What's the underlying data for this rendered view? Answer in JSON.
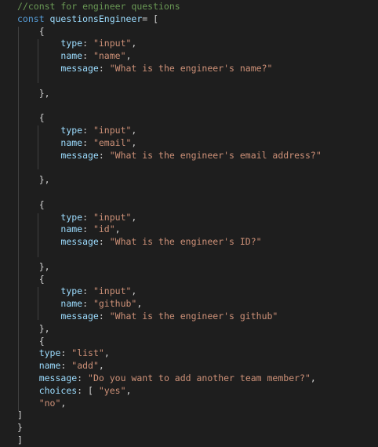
{
  "editor": {
    "theme_colors": {
      "background": "#1e1e1e",
      "comment": "#6a9955",
      "keyword": "#569cd6",
      "property": "#9cdcfe",
      "string": "#ce9178",
      "text": "#d4d4d4"
    },
    "lines": [
      {
        "indent": 0,
        "tokens": [
          {
            "t": "c",
            "v": "//const for engineer questions"
          }
        ]
      },
      {
        "indent": 0,
        "tokens": [
          {
            "t": "k",
            "v": "const "
          },
          {
            "t": "v",
            "v": "questionsEngineer"
          },
          {
            "t": "p",
            "v": "= ["
          }
        ]
      },
      {
        "indent": 1,
        "tokens": [
          {
            "t": "p",
            "v": "{"
          }
        ]
      },
      {
        "indent": 2,
        "tokens": [
          {
            "t": "v",
            "v": "type"
          },
          {
            "t": "p",
            "v": ": "
          },
          {
            "t": "s",
            "v": "\"input\""
          },
          {
            "t": "p",
            "v": ","
          }
        ]
      },
      {
        "indent": 2,
        "tokens": [
          {
            "t": "v",
            "v": "name"
          },
          {
            "t": "p",
            "v": ": "
          },
          {
            "t": "s",
            "v": "\"name\""
          },
          {
            "t": "p",
            "v": ","
          }
        ]
      },
      {
        "indent": 2,
        "tokens": [
          {
            "t": "v",
            "v": "message"
          },
          {
            "t": "p",
            "v": ": "
          },
          {
            "t": "s",
            "v": "\"What is the engineer's name?\""
          }
        ]
      },
      {
        "indent": 0,
        "tokens": []
      },
      {
        "indent": 1,
        "tokens": [
          {
            "t": "p",
            "v": "},"
          }
        ]
      },
      {
        "indent": 0,
        "tokens": []
      },
      {
        "indent": 1,
        "tokens": [
          {
            "t": "p",
            "v": "{"
          }
        ]
      },
      {
        "indent": 2,
        "tokens": [
          {
            "t": "v",
            "v": "type"
          },
          {
            "t": "p",
            "v": ": "
          },
          {
            "t": "s",
            "v": "\"input\""
          },
          {
            "t": "p",
            "v": ","
          }
        ]
      },
      {
        "indent": 2,
        "tokens": [
          {
            "t": "v",
            "v": "name"
          },
          {
            "t": "p",
            "v": ": "
          },
          {
            "t": "s",
            "v": "\"email\""
          },
          {
            "t": "p",
            "v": ","
          }
        ]
      },
      {
        "indent": 2,
        "tokens": [
          {
            "t": "v",
            "v": "message"
          },
          {
            "t": "p",
            "v": ": "
          },
          {
            "t": "s",
            "v": "\"What is the engineer's email address?\""
          }
        ]
      },
      {
        "indent": 0,
        "tokens": []
      },
      {
        "indent": 1,
        "tokens": [
          {
            "t": "p",
            "v": "},"
          }
        ]
      },
      {
        "indent": 0,
        "tokens": []
      },
      {
        "indent": 1,
        "tokens": [
          {
            "t": "p",
            "v": "{"
          }
        ]
      },
      {
        "indent": 2,
        "tokens": [
          {
            "t": "v",
            "v": "type"
          },
          {
            "t": "p",
            "v": ": "
          },
          {
            "t": "s",
            "v": "\"input\""
          },
          {
            "t": "p",
            "v": ","
          }
        ]
      },
      {
        "indent": 2,
        "tokens": [
          {
            "t": "v",
            "v": "name"
          },
          {
            "t": "p",
            "v": ": "
          },
          {
            "t": "s",
            "v": "\"id\""
          },
          {
            "t": "p",
            "v": ","
          }
        ]
      },
      {
        "indent": 2,
        "tokens": [
          {
            "t": "v",
            "v": "message"
          },
          {
            "t": "p",
            "v": ": "
          },
          {
            "t": "s",
            "v": "\"What is the engineer's ID?\""
          }
        ]
      },
      {
        "indent": 0,
        "tokens": []
      },
      {
        "indent": 1,
        "tokens": [
          {
            "t": "p",
            "v": "},"
          }
        ]
      },
      {
        "indent": 1,
        "tokens": [
          {
            "t": "p",
            "v": "{"
          }
        ]
      },
      {
        "indent": 2,
        "tokens": [
          {
            "t": "v",
            "v": "type"
          },
          {
            "t": "p",
            "v": ": "
          },
          {
            "t": "s",
            "v": "\"input\""
          },
          {
            "t": "p",
            "v": ","
          }
        ]
      },
      {
        "indent": 2,
        "tokens": [
          {
            "t": "v",
            "v": "name"
          },
          {
            "t": "p",
            "v": ": "
          },
          {
            "t": "s",
            "v": "\"github\""
          },
          {
            "t": "p",
            "v": ","
          }
        ]
      },
      {
        "indent": 2,
        "tokens": [
          {
            "t": "v",
            "v": "message"
          },
          {
            "t": "p",
            "v": ": "
          },
          {
            "t": "s",
            "v": "\"What is the engineer's github\""
          }
        ]
      },
      {
        "indent": 1,
        "tokens": [
          {
            "t": "p",
            "v": "},"
          }
        ]
      },
      {
        "indent": 1,
        "tokens": [
          {
            "t": "p",
            "v": "{"
          }
        ]
      },
      {
        "indent": 1,
        "tokens": [
          {
            "t": "v",
            "v": "type"
          },
          {
            "t": "p",
            "v": ": "
          },
          {
            "t": "s",
            "v": "\"list\""
          },
          {
            "t": "p",
            "v": ","
          }
        ]
      },
      {
        "indent": 1,
        "tokens": [
          {
            "t": "v",
            "v": "name"
          },
          {
            "t": "p",
            "v": ": "
          },
          {
            "t": "s",
            "v": "\"add\""
          },
          {
            "t": "p",
            "v": ","
          }
        ]
      },
      {
        "indent": 1,
        "tokens": [
          {
            "t": "v",
            "v": "message"
          },
          {
            "t": "p",
            "v": ": "
          },
          {
            "t": "s",
            "v": "\"Do you want to add another team member?\""
          },
          {
            "t": "p",
            "v": ","
          }
        ]
      },
      {
        "indent": 1,
        "tokens": [
          {
            "t": "v",
            "v": "choices"
          },
          {
            "t": "p",
            "v": ": [ "
          },
          {
            "t": "s",
            "v": "\"yes\""
          },
          {
            "t": "p",
            "v": ","
          }
        ]
      },
      {
        "indent": 1,
        "tokens": [
          {
            "t": "s",
            "v": "\"no\""
          },
          {
            "t": "p",
            "v": ","
          }
        ]
      },
      {
        "indent": 0,
        "tokens": [
          {
            "t": "p",
            "v": "]"
          }
        ]
      },
      {
        "indent": 0,
        "tokens": [
          {
            "t": "p",
            "v": "}"
          }
        ]
      },
      {
        "indent": 0,
        "tokens": [
          {
            "t": "p",
            "v": "]"
          }
        ]
      }
    ]
  }
}
